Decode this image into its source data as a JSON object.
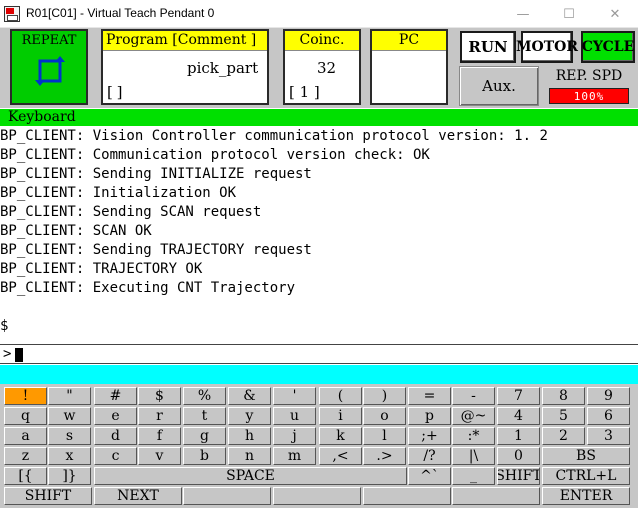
{
  "window": {
    "title": "R01[C01] - Virtual Teach Pendant 0",
    "minimize_glyph": "—",
    "maximize_glyph": "☐",
    "close_glyph": "✕"
  },
  "status": {
    "repeat_label": "REPEAT",
    "program_header": "Program    [Comment ]",
    "program_name": "pick_part",
    "program_comment": "[                    ]",
    "coinc_header": "Coinc.",
    "coinc_value": "32",
    "coinc_bracket": "[    1 ]",
    "pc_header": "PC",
    "run_label": "RUN",
    "motor_label": "MOTOR",
    "cycle_label": "CYCLE",
    "aux_label": "Aux.",
    "rep_spd_label": "REP. SPD",
    "rep_spd_value": "100%"
  },
  "colors": {
    "green": "#00cc00",
    "yellow": "#ffff00",
    "cyan": "#00ffff",
    "red": "#ff0000",
    "active_key": "#ff9900"
  },
  "keyboard_header": "Keyboard",
  "console": {
    "lines": [
      "BP_CLIENT: Vision Controller communication protocol version:  1. 2",
      "BP_CLIENT: Communication protocol version check: OK",
      "BP_CLIENT: Sending INITIALIZE request",
      "BP_CLIENT: Initialization OK",
      "BP_CLIENT: Sending SCAN request",
      "BP_CLIENT: SCAN OK",
      "BP_CLIENT: Sending TRAJECTORY request",
      "BP_CLIENT: TRAJECTORY OK",
      "BP_CLIENT: Executing CNT Trajectory",
      "",
      "$"
    ],
    "prompt": ">"
  },
  "keyboard": {
    "row1": [
      "!",
      "\"",
      "#",
      "$",
      "%",
      "&",
      "'",
      "(",
      ")",
      "=",
      "-",
      "7",
      "8",
      "9"
    ],
    "row2": [
      "q",
      "w",
      "e",
      "r",
      "t",
      "y",
      "u",
      "i",
      "o",
      "p",
      "@~",
      "4",
      "5",
      "6"
    ],
    "row3": [
      "a",
      "s",
      "d",
      "f",
      "g",
      "h",
      "j",
      "k",
      "l",
      ";+",
      ":*",
      "1",
      "2",
      "3"
    ],
    "row4": [
      "z",
      "x",
      "c",
      "v",
      "b",
      "n",
      "m",
      ",<",
      ".>",
      "/?",
      "|\\",
      "0",
      "BS"
    ],
    "row5": [
      "[{",
      "]}",
      "SPACE",
      "^`",
      "_",
      "SHIFT",
      "CTRL+L"
    ],
    "row6": [
      "SHIFT",
      "NEXT",
      "",
      "",
      "",
      "",
      "ENTER"
    ]
  }
}
